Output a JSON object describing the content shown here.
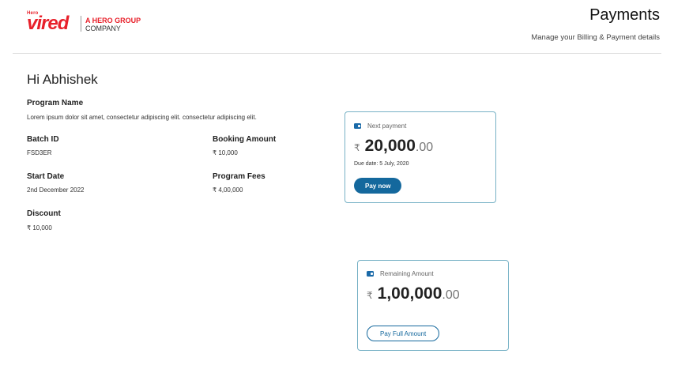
{
  "brand": {
    "logo_small": "Hero",
    "logo_main": "vired",
    "tagline_highlight": "A HERO GROUP",
    "tagline_rest": "COMPANY",
    "accent_color": "#e8202a"
  },
  "header": {
    "title": "Payments",
    "subtitle": "Manage your Billing & Payment details"
  },
  "greeting": "Hi Abhishek",
  "program": {
    "label": "Program Name",
    "value": "Lorem ipsum dolor sit amet, consectetur adipiscing elit. consectetur adipiscing elit."
  },
  "details": {
    "batch_id": {
      "label": "Batch ID",
      "value": "FSD3ER"
    },
    "booking_amount": {
      "label": "Booking Amount",
      "value": "₹ 10,000"
    },
    "start_date": {
      "label": "Start Date",
      "value": "2nd December 2022"
    },
    "program_fees": {
      "label": "Program Fees",
      "value": "₹ 4,00,000"
    },
    "discount": {
      "label": "Discount",
      "value": "₹ 10,000"
    }
  },
  "next_payment": {
    "icon": "wallet-icon",
    "label": "Next payment",
    "currency": "₹",
    "amount": "20,000",
    "decimals": ".00",
    "due": "Due date: 5 July, 2020",
    "button": "Pay now"
  },
  "remaining": {
    "icon": "wallet-icon",
    "label": "Remaining Amount",
    "currency": "₹",
    "amount": "1,00,000",
    "decimals": ".00",
    "button": "Pay Full Amount"
  },
  "colors": {
    "primary": "#14689d",
    "card_border": "#78b2c6"
  }
}
